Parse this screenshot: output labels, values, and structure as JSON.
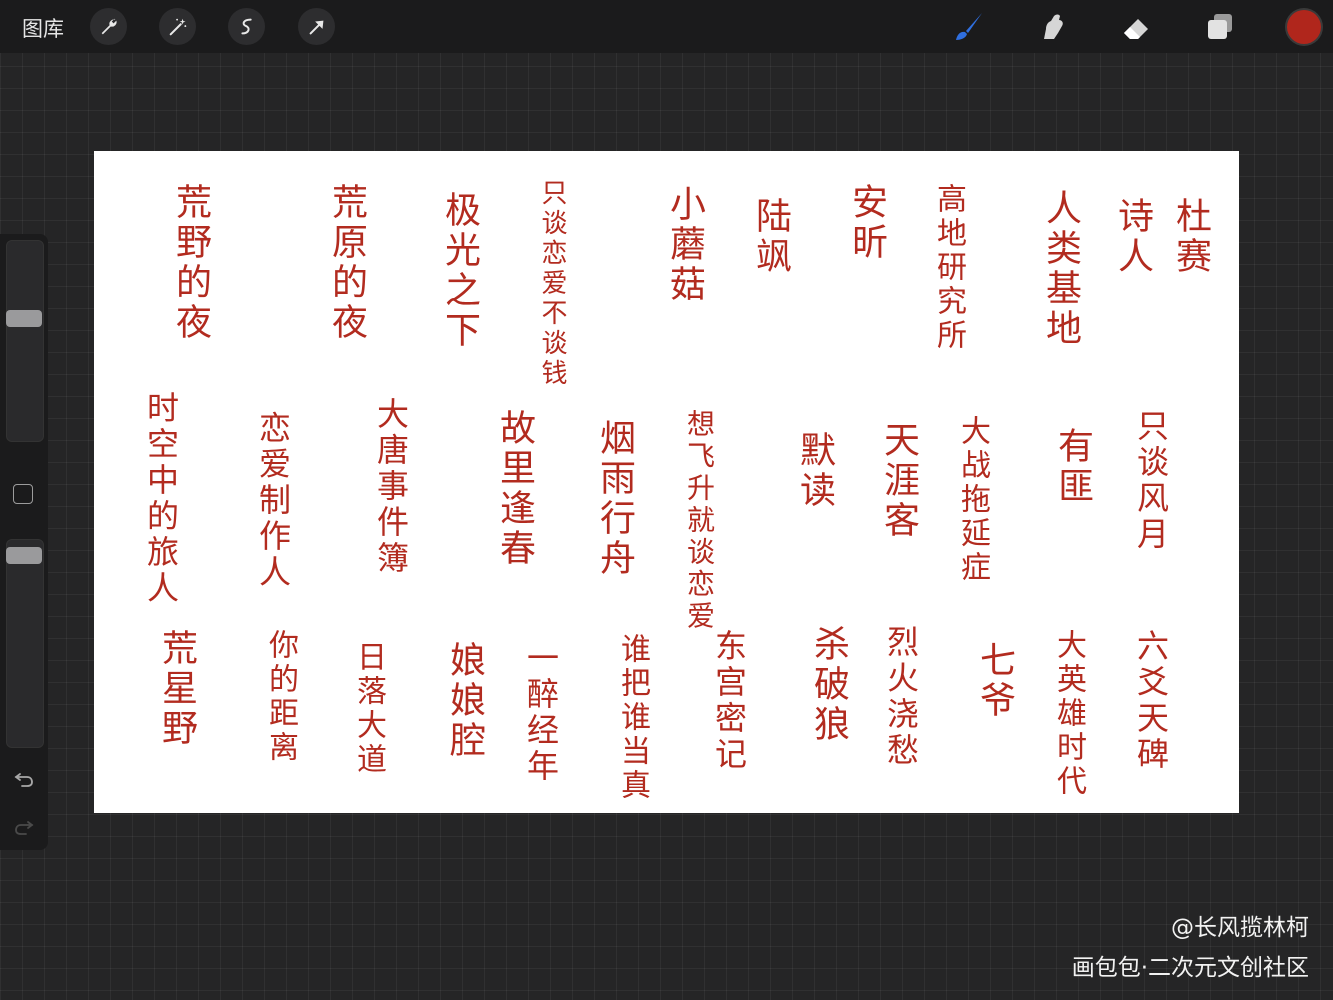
{
  "toolbar": {
    "gallery_label": "图库",
    "left_tools": [
      "wrench-icon",
      "magic-wand-icon",
      "selection-icon",
      "transform-arrow-icon"
    ],
    "right_tools": [
      "brush-icon",
      "smudge-icon",
      "eraser-icon",
      "layers-icon"
    ],
    "active_tool": "brush-icon",
    "accent_color": "#2f6fe0",
    "current_color": "#b0261c"
  },
  "sidebar": {
    "brush_size_level": 0.62,
    "opacity_level": 0.96,
    "icons": [
      "modify-square-icon",
      "undo-icon",
      "redo-icon"
    ]
  },
  "canvas": {
    "ink_color": "#b22b1f",
    "row1": [
      "荒野的夜",
      "荒原的夜",
      "极光之下",
      "只谈恋爱不谈钱",
      "小蘑菇",
      "陆飒",
      "安昕",
      "高地研究所",
      "人类基地",
      "诗人",
      "杜赛"
    ],
    "row2": [
      "时空中的旅人",
      "恋爱制作人",
      "大唐事件簿",
      "故里逢春",
      "烟雨行舟",
      "想飞升就谈恋爱",
      "默读",
      "天涯客",
      "大战拖延症",
      "有匪",
      "只谈风月"
    ],
    "row3": [
      "荒星野",
      "你的距离",
      "日落大道",
      "娘娘腔",
      "一醉经年",
      "谁把谁当真",
      "东宫密记",
      "杀破狼",
      "烈火浇愁",
      "七爷",
      "大英雄时代",
      "六爻天碑"
    ]
  },
  "watermark": {
    "line1": "@长风揽林柯",
    "line2": "画包包·二次元文创社区"
  }
}
